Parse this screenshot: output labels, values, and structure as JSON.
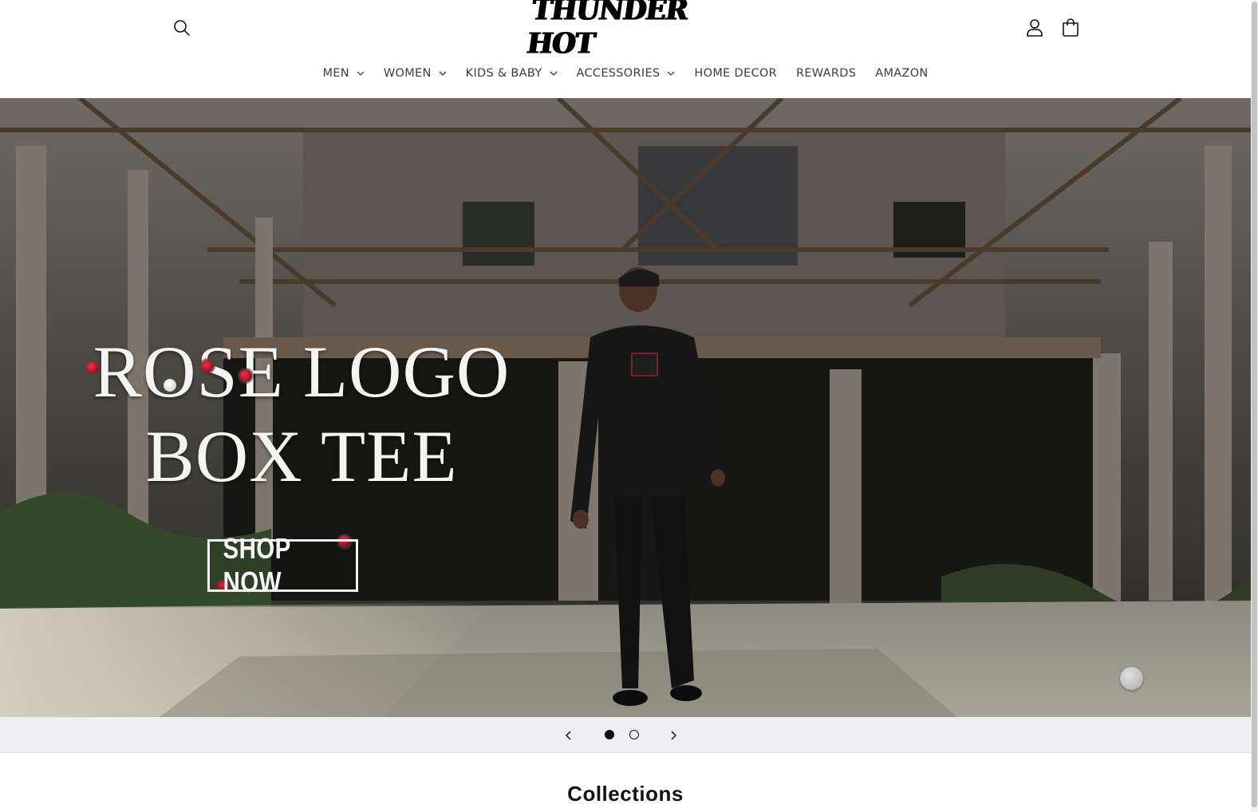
{
  "brand": {
    "logo_text": "THUNDER HOT"
  },
  "header": {
    "icons": [
      "search-icon",
      "account-icon",
      "cart-icon"
    ]
  },
  "nav": {
    "items": [
      {
        "label": "MEN",
        "has_dropdown": true
      },
      {
        "label": "WOMEN",
        "has_dropdown": true
      },
      {
        "label": "KIDS & BABY",
        "has_dropdown": true
      },
      {
        "label": "ACCESSORIES",
        "has_dropdown": true
      },
      {
        "label": "HOME DECOR",
        "has_dropdown": false
      },
      {
        "label": "REWARDS",
        "has_dropdown": false
      },
      {
        "label": "AMAZON",
        "has_dropdown": false
      }
    ]
  },
  "hero": {
    "title_line1": "ROSE LOGO",
    "title_line2": "BOX TEE",
    "cta_label": "SHOP NOW"
  },
  "slider": {
    "slide_count": 2,
    "active_slide": 1
  },
  "collections": {
    "title": "Collections"
  },
  "colors": {
    "text": "#121212",
    "nav_text": "#3d3d3d",
    "slider_bar": "#eeeef3",
    "background": "#ffffff"
  }
}
